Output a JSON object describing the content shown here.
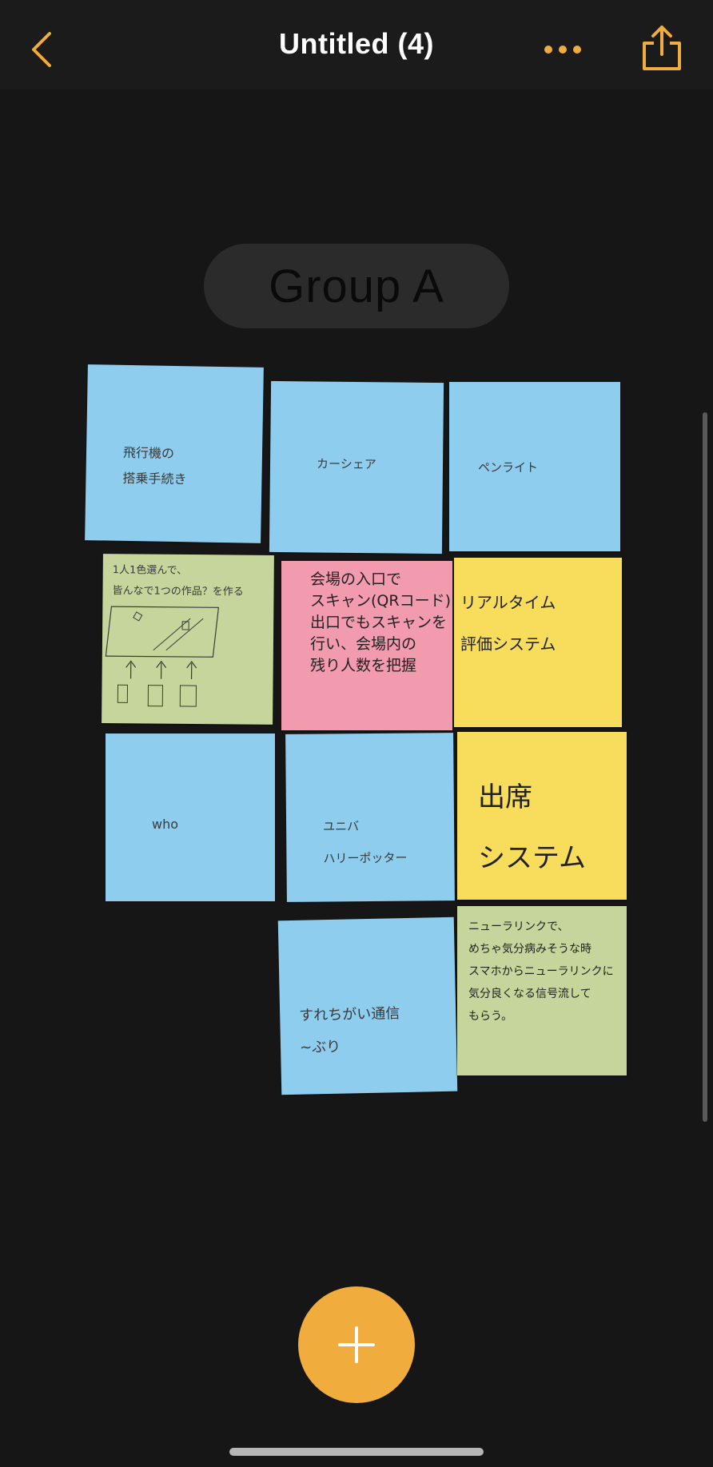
{
  "app": {
    "title": "Untitled (4)",
    "accent_color": "#f0ac3c"
  },
  "toolbar": {
    "back_icon": "chevron-left-icon",
    "more_icon": "ellipsis-icon",
    "share_icon": "share-icon"
  },
  "board": {
    "group_label": "Group A",
    "notes": [
      {
        "color": "blue",
        "text": "飛行機の\n搭乗手続き"
      },
      {
        "color": "blue",
        "text": "カーシェア"
      },
      {
        "color": "blue",
        "text": "ペンライト"
      },
      {
        "color": "green",
        "text": "1人1色選んで、\n皆んなで1つの作品？を作る"
      },
      {
        "color": "pink",
        "text": "会場の入口で\nスキャン(QRコード)\n出口でもスキャンを\n行い、会場内の\n残り人数を把握"
      },
      {
        "color": "yellow",
        "text": "リアルタイム\n評価システム"
      },
      {
        "color": "blue",
        "text": "who"
      },
      {
        "color": "blue",
        "text": "ユニバ\nハリーポッター"
      },
      {
        "color": "yellow",
        "text": "出席\nシステム"
      },
      {
        "color": "blue",
        "text": "すれちがい通信\n~ぶり"
      },
      {
        "color": "green",
        "text": "ニューラリンクで、\nめちゃ気分病みそうな時\nスマホからニューラリンクに\n気分良くなる信号流して\nもらう。"
      }
    ]
  },
  "fab": {
    "icon": "plus-icon"
  }
}
